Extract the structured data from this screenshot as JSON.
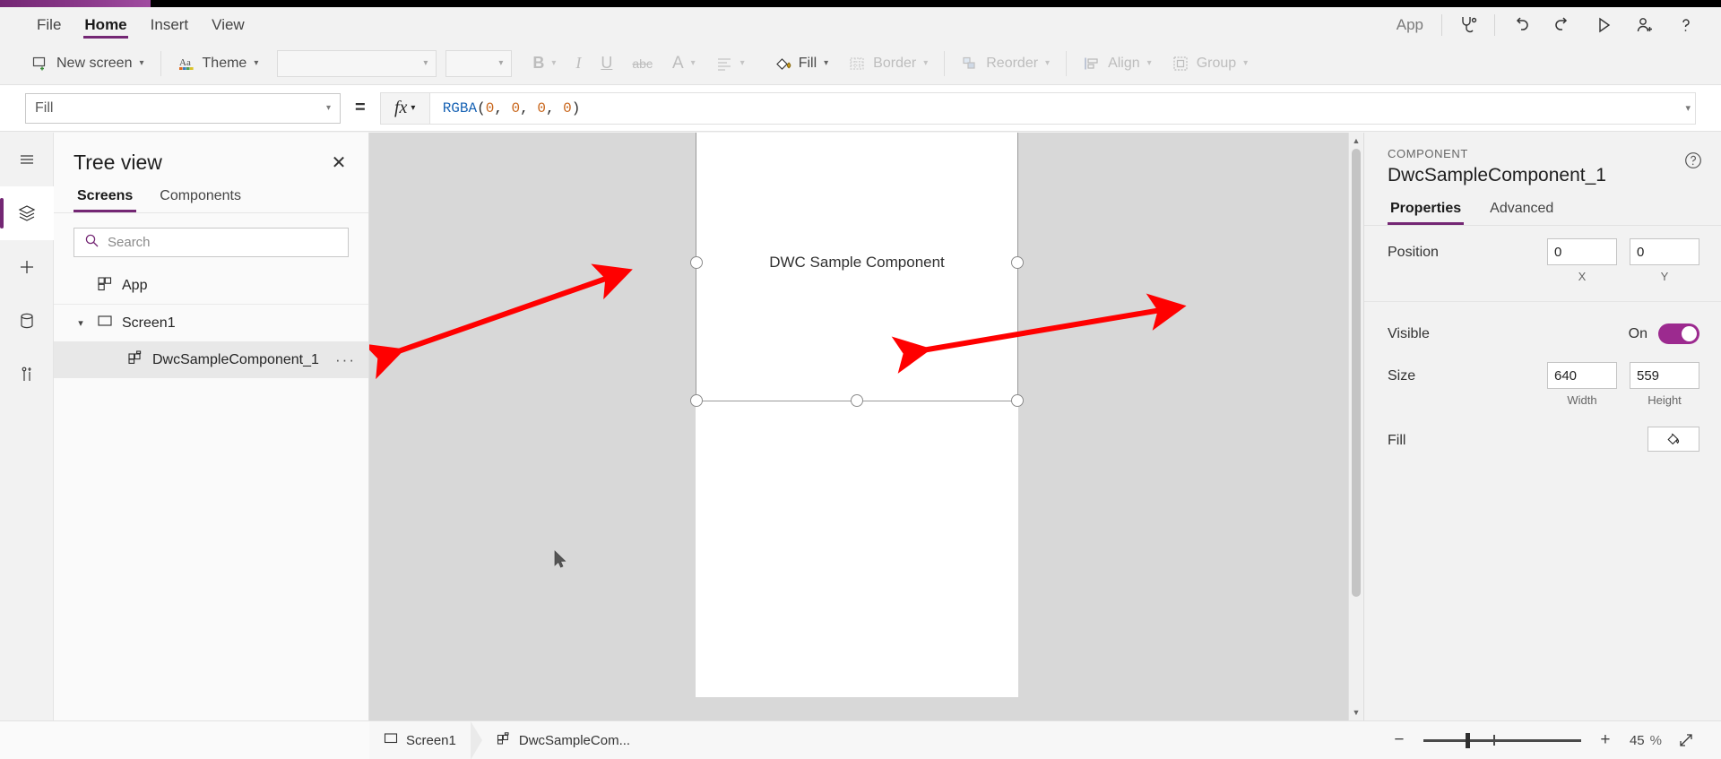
{
  "theme": {
    "accent": "#742774",
    "toggle_on": "#9c2a8f",
    "annotation": "#ff0000"
  },
  "menubar": {
    "items": [
      {
        "label": "File",
        "active": false
      },
      {
        "label": "Home",
        "active": true
      },
      {
        "label": "Insert",
        "active": false
      },
      {
        "label": "View",
        "active": false
      }
    ],
    "app_label": "App",
    "icons": [
      {
        "name": "app-checker-icon",
        "title": "App checker"
      },
      {
        "name": "undo-icon",
        "title": "Undo"
      },
      {
        "name": "redo-icon",
        "title": "Redo"
      },
      {
        "name": "preview-icon",
        "title": "Preview the app"
      },
      {
        "name": "share-icon",
        "title": "Share"
      },
      {
        "name": "help-icon",
        "title": "Help"
      }
    ]
  },
  "ribbon": {
    "new_screen": "New screen",
    "theme": "Theme",
    "font_family_value": "",
    "font_size_value": "",
    "bold": "B",
    "italic": "I",
    "underline": "U",
    "strikethrough": "abc",
    "font_color": "A",
    "align": "align-icon",
    "fill": "Fill",
    "border": "Border",
    "reorder": "Reorder",
    "align_group": "Align",
    "group": "Group"
  },
  "formulabar": {
    "property": "Fill",
    "equals": "=",
    "fx": "fx",
    "formula_function": "RGBA",
    "formula_args": [
      "0",
      "0",
      "0",
      "0"
    ],
    "formula_text": "RGBA(0, 0, 0, 0)"
  },
  "rail": {
    "items": [
      {
        "name": "hamburger-icon",
        "label": "Menu",
        "active": false
      },
      {
        "name": "tree-view-icon",
        "label": "Tree view",
        "active": true
      },
      {
        "name": "insert-icon",
        "label": "Insert",
        "active": false
      },
      {
        "name": "data-icon",
        "label": "Data",
        "active": false
      },
      {
        "name": "variables-icon",
        "label": "Variables",
        "active": false
      }
    ]
  },
  "treeview": {
    "title": "Tree view",
    "close": "✕",
    "tabs": [
      {
        "label": "Screens",
        "active": true
      },
      {
        "label": "Components",
        "active": false
      }
    ],
    "search_placeholder": "Search",
    "search_value": "",
    "items": [
      {
        "label": "App",
        "icon": "app-icon",
        "level": 0,
        "expandable": false,
        "selected": false,
        "menu": false
      },
      {
        "label": "Screen1",
        "icon": "screen-icon",
        "level": 0,
        "expandable": true,
        "expanded": true,
        "selected": false,
        "menu": false
      },
      {
        "label": "DwcSampleComponent_1",
        "icon": "component-icon",
        "level": 1,
        "expandable": false,
        "selected": true,
        "menu": true,
        "menu_glyph": "···"
      }
    ]
  },
  "canvas": {
    "component_label": "DWC Sample Component",
    "selection_handles": 8,
    "annotations": [
      {
        "name": "resize-arrow-left",
        "type": "double-arrow",
        "color": "#ff0000"
      },
      {
        "name": "resize-arrow-right",
        "type": "double-arrow",
        "color": "#ff0000"
      }
    ]
  },
  "properties": {
    "kicker": "COMPONENT",
    "name": "DwcSampleComponent_1",
    "help": "?",
    "tabs": [
      {
        "label": "Properties",
        "active": true
      },
      {
        "label": "Advanced",
        "active": false
      }
    ],
    "rows": [
      {
        "label": "Position",
        "type": "pair",
        "fields": [
          {
            "value": "0",
            "caption": "X"
          },
          {
            "value": "0",
            "caption": "Y"
          }
        ]
      },
      {
        "label": "Visible",
        "type": "toggle",
        "state_label": "On",
        "state": true
      },
      {
        "label": "Size",
        "type": "pair",
        "fields": [
          {
            "value": "640",
            "caption": "Width"
          },
          {
            "value": "559",
            "caption": "Height"
          }
        ]
      },
      {
        "label": "Fill",
        "type": "color",
        "swatch_icon": "paint-bucket-icon"
      }
    ]
  },
  "statusbar": {
    "breadcrumb": [
      {
        "label": "Screen1",
        "icon": "screen-icon"
      },
      {
        "label": "DwcSampleCom...",
        "icon": "component-icon"
      }
    ],
    "zoom_out": "−",
    "zoom_in": "+",
    "zoom_value": "45",
    "zoom_unit": "%",
    "fit_screen": "fit-screen-icon"
  }
}
